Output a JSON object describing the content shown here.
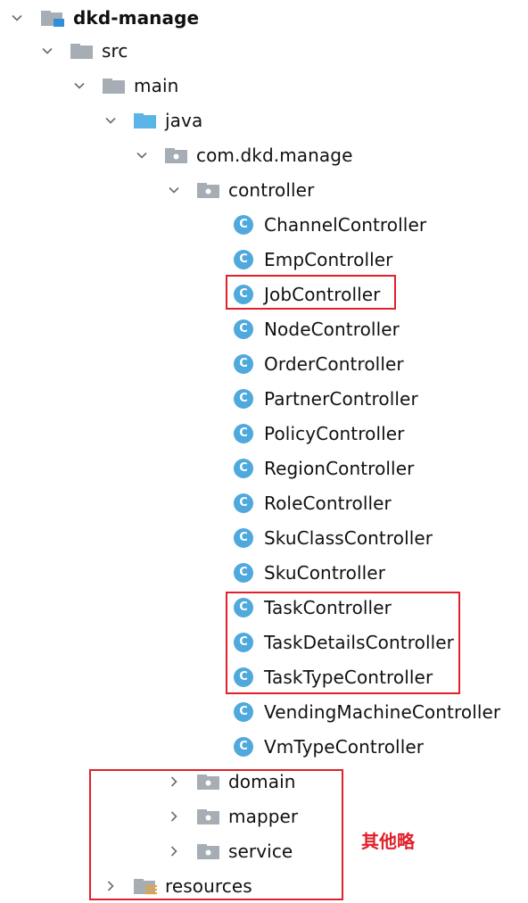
{
  "tree": {
    "root": {
      "label": "dkd-manage",
      "icon": "module-folder-icon",
      "expanded": true
    },
    "src": {
      "label": "src",
      "icon": "folder-icon",
      "expanded": true
    },
    "main": {
      "label": "main",
      "icon": "folder-icon",
      "expanded": true
    },
    "java": {
      "label": "java",
      "icon": "source-root-folder-icon",
      "expanded": true
    },
    "package": {
      "label": "com.dkd.manage",
      "icon": "package-icon",
      "expanded": true
    },
    "controller": {
      "label": "controller",
      "icon": "package-icon",
      "expanded": true
    },
    "classes": [
      {
        "label": "ChannelController",
        "icon": "class-icon"
      },
      {
        "label": "EmpController",
        "icon": "class-icon"
      },
      {
        "label": "JobController",
        "icon": "class-icon"
      },
      {
        "label": "NodeController",
        "icon": "class-icon"
      },
      {
        "label": "OrderController",
        "icon": "class-icon"
      },
      {
        "label": "PartnerController",
        "icon": "class-icon"
      },
      {
        "label": "PolicyController",
        "icon": "class-icon"
      },
      {
        "label": "RegionController",
        "icon": "class-icon"
      },
      {
        "label": "RoleController",
        "icon": "class-icon"
      },
      {
        "label": "SkuClassController",
        "icon": "class-icon"
      },
      {
        "label": "SkuController",
        "icon": "class-icon"
      },
      {
        "label": "TaskController",
        "icon": "class-icon"
      },
      {
        "label": "TaskDetailsController",
        "icon": "class-icon"
      },
      {
        "label": "TaskTypeController",
        "icon": "class-icon"
      },
      {
        "label": "VendingMachineController",
        "icon": "class-icon"
      },
      {
        "label": "VmTypeController",
        "icon": "class-icon"
      }
    ],
    "class_icon_letter": "C",
    "domain": {
      "label": "domain",
      "icon": "package-icon",
      "expanded": false
    },
    "mapper": {
      "label": "mapper",
      "icon": "package-icon",
      "expanded": false
    },
    "service": {
      "label": "service",
      "icon": "package-icon",
      "expanded": false
    },
    "resources": {
      "label": "resources",
      "icon": "resources-folder-icon",
      "expanded": false
    }
  },
  "annotation": {
    "note": "其他略",
    "color": "#e0202a"
  },
  "colors": {
    "folder_gray": "#a7adb4",
    "java_blue": "#5ab4e6",
    "class_blue": "#4fa9dd",
    "highlight_red": "#e0202a"
  }
}
